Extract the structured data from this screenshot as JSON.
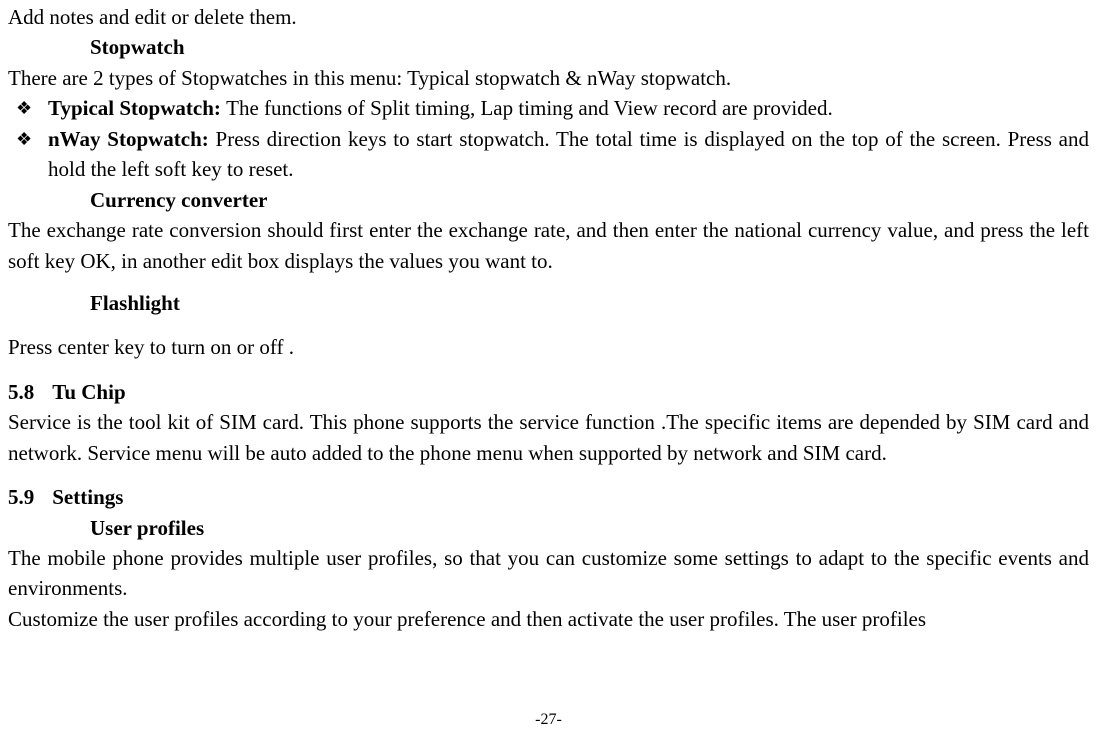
{
  "intro_line": "Add notes and edit or delete them.",
  "stopwatch": {
    "heading": "Stopwatch",
    "desc": "There are 2 types of Stopwatches in this menu: Typical stopwatch & nWay stopwatch.",
    "items": [
      {
        "title": "Typical Stopwatch: ",
        "text": "The functions of Split timing, Lap timing and View record are provided."
      },
      {
        "title": "nWay Stopwatch: ",
        "text": "Press direction keys to start stopwatch. The total time is displayed on the top of the screen. Press and hold the left soft key to reset."
      }
    ]
  },
  "currency": {
    "heading": "Currency converter",
    "desc": "The exchange rate conversion should first enter the exchange rate, and then enter the national currency value, and press the left soft key OK, in another edit box displays the values you want to."
  },
  "flashlight": {
    "heading": "Flashlight",
    "desc": "Press center key to turn on or off ."
  },
  "tuchip": {
    "num": "5.8",
    "title": "Tu Chip",
    "desc": "Service is the tool kit of SIM card. This phone supports the service function .The specific items are depended by SIM card and network. Service menu will be auto added to the phone menu when supported by network and SIM card."
  },
  "settings": {
    "num": "5.9",
    "title": "Settings",
    "sub": "User profiles",
    "p1": "The mobile phone provides multiple user profiles, so that you can customize some settings to adapt to the specific events and environments.",
    "p2": "Customize the user profiles according to your preference and then activate the user profiles. The user profiles"
  },
  "page_number": "-27-"
}
